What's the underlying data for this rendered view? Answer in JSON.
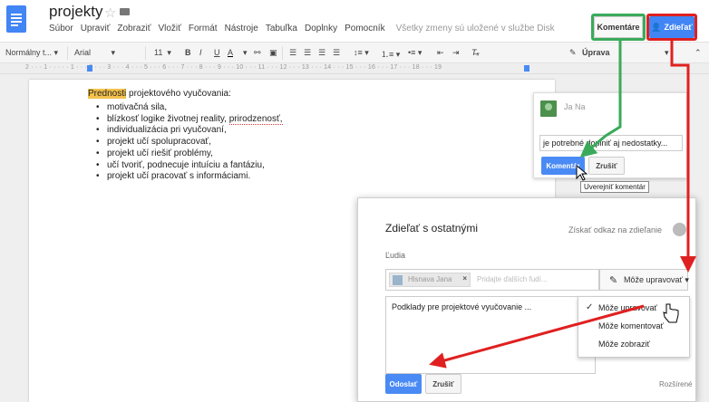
{
  "header": {
    "doc_title": "projekty",
    "menu": [
      "Súbor",
      "Upraviť",
      "Zobraziť",
      "Vložiť",
      "Formát",
      "Nástroje",
      "Tabuľka",
      "Doplnky",
      "Pomocník"
    ],
    "save_status": "Všetky zmeny sú uložené v službe Disk",
    "comments_label": "Komentáre",
    "share_label": "Zdieľať"
  },
  "toolbar": {
    "style": "Normálny t...",
    "font": "Arial",
    "size": "11",
    "bold": "B",
    "italic": "I",
    "underline": "U",
    "color": "A",
    "mode": "Úprava"
  },
  "ruler": {
    "text": "2 · · · 1 · · · · · 1 · · · 2 · · · 3 · · · 4 · · · 5 · · · 6 · · · 7 · · · 8 · · · 9 · · · 10 · · · 11 · · · 12 · · · 13 · · · 14 · · · 15 · · · 16 · · · 17 · · · 18 · · · 19"
  },
  "document": {
    "heading_highlight": "Prednosti",
    "heading_rest": "projektového vyučovania:",
    "items": [
      "motivačná sila,",
      "blízkosť logike životnej reality,",
      "individualizácia pri vyučovaní,",
      "projekt učí spolupracovať,",
      "projekt učí riešiť problémy,",
      "učí tvoriť, podnecuje intuíciu a fantáziu,",
      "projekt učí pracovať s informáciami."
    ],
    "item2_underlined": "prirodzenosť,"
  },
  "comment": {
    "user": "Ja Na",
    "text": "je potrebné doplniť aj nedostatky...",
    "submit": "Komentár",
    "cancel": "Zrušiť",
    "tooltip": "Uverejniť komentár"
  },
  "share_dialog": {
    "title": "Zdieľať s ostatnými",
    "link_label": "Získať odkaz na zdieľanie",
    "people_label": "Ľudia",
    "chip_name": "Hlsnava Jana",
    "chip_remove": "×",
    "add_placeholder": "Pridajte ďalších ľudí...",
    "permission": "Môže upravovať",
    "note": "Podklady pre projektové vyučovanie ...",
    "options": [
      "Môže upravovať",
      "Môže komentovať",
      "Môže zobraziť"
    ],
    "send": "Odoslať",
    "cancel": "Zrušiť",
    "advanced": "Rozšírené"
  },
  "colors": {
    "accent_blue": "#4285f4",
    "highlight_green": "#3aaa5a",
    "highlight_red": "#e02020",
    "text_highlight": "#f3c14c"
  }
}
